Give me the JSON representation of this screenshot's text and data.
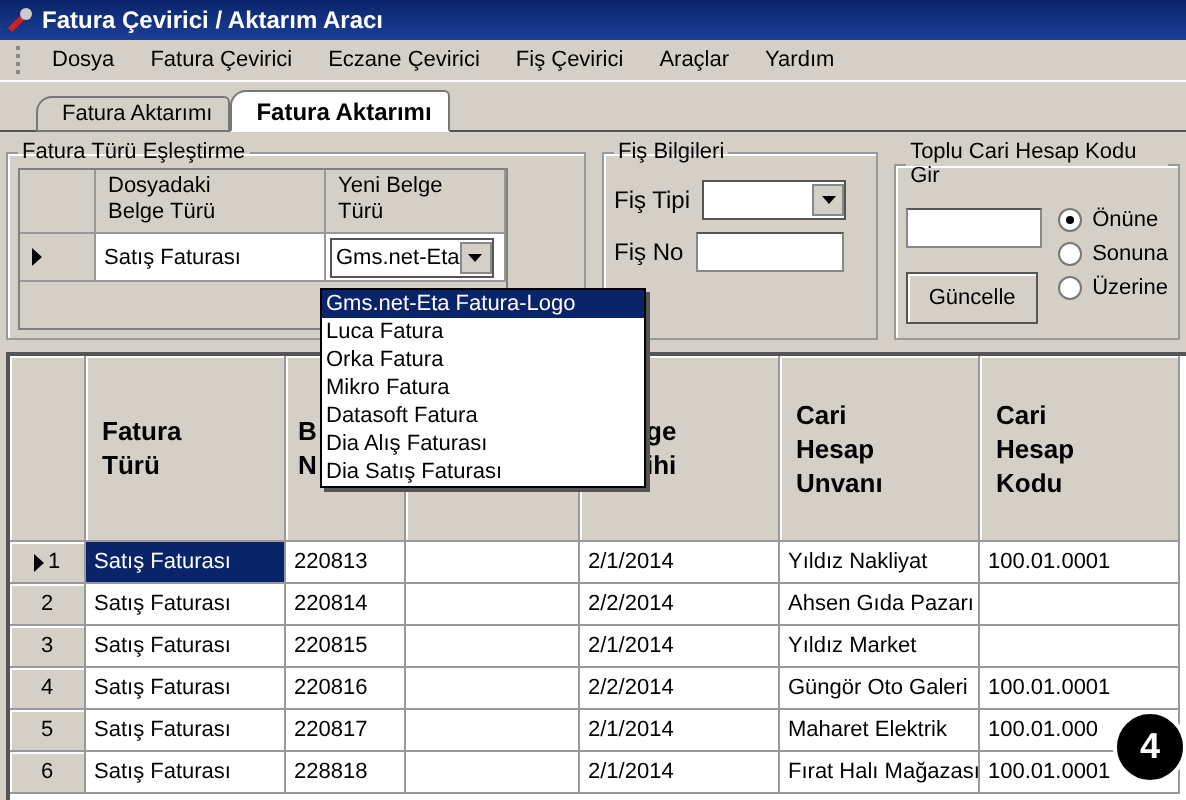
{
  "window": {
    "title": "Fatura Çevirici / Aktarım Aracı"
  },
  "menu": [
    "Dosya",
    "Fatura Çevirici",
    "Eczane Çevirici",
    "Fiş Çevirici",
    "Araçlar",
    "Yardım"
  ],
  "tabs": [
    {
      "label": "Fatura Aktarımı",
      "selected": false
    },
    {
      "label": "Fatura Aktarımı",
      "selected": true
    }
  ],
  "mapping": {
    "title": "Fatura Türü Eşleştirme",
    "columns": [
      "Dosyadaki\nBelge Türü",
      "Yeni Belge\nTürü"
    ],
    "rows": [
      {
        "current": true,
        "source": "Satış Faturası",
        "target": "Gms.net-Eta"
      }
    ],
    "options": [
      {
        "label": "Gms.net-Eta Fatura-Logo",
        "selected": true
      },
      {
        "label": "Luca Fatura",
        "selected": false
      },
      {
        "label": "Orka Fatura",
        "selected": false
      },
      {
        "label": "Mikro Fatura",
        "selected": false
      },
      {
        "label": "Datasoft Fatura",
        "selected": false
      },
      {
        "label": "Dia Alış Faturası",
        "selected": false
      },
      {
        "label": "Dia Satış Faturası",
        "selected": false
      }
    ]
  },
  "receipt": {
    "title": "Fiş Bilgileri",
    "type_label": "Fiş Tipi",
    "no_label": "Fiş No"
  },
  "bulk": {
    "title": "Toplu Cari Hesap Kodu Gir",
    "button": "Güncelle",
    "options": [
      {
        "label": "Önüne",
        "selected": true
      },
      {
        "label": "Sonuna",
        "selected": false
      },
      {
        "label": "Üzerine",
        "selected": false
      }
    ]
  },
  "table": {
    "columns": [
      {
        "label": "Fatura\nTürü"
      },
      {
        "label": "B\nN"
      },
      {},
      {
        "label": "ge\nihi"
      },
      {
        "label": "Cari\nHesap\nUnvanı"
      },
      {
        "label": "Cari\nHesap\nKodu"
      }
    ],
    "rows": [
      {
        "number": "1",
        "current": true,
        "cells": [
          "Satış Faturası",
          "220813",
          "",
          "2/1/2014",
          "Yıldız Nakliyat",
          "100.01.0001"
        ],
        "selected": true
      },
      {
        "number": "2",
        "current": false,
        "cells": [
          "Satış Faturası",
          "220814",
          "",
          "2/2/2014",
          "Ahsen Gıda Pazarı",
          ""
        ],
        "selected": false
      },
      {
        "number": "3",
        "current": false,
        "cells": [
          "Satış Faturası",
          "220815",
          "",
          "2/1/2014",
          "Yıldız Market",
          ""
        ],
        "selected": false
      },
      {
        "number": "4",
        "current": false,
        "cells": [
          "Satış Faturası",
          "220816",
          "",
          "2/2/2014",
          "Güngör Oto Galeri",
          "100.01.0001"
        ],
        "selected": false
      },
      {
        "number": "5",
        "current": false,
        "cells": [
          "Satış Faturası",
          "220817",
          "",
          "2/1/2014",
          "Maharet Elektrik",
          "100.01.000"
        ],
        "selected": false
      },
      {
        "number": "6",
        "current": false,
        "cells": [
          "Satış Faturası",
          "228818",
          "",
          "2/1/2014",
          "Fırat Halı Mağazası",
          "100.01.0001"
        ],
        "selected": false
      }
    ]
  },
  "badge": "4"
}
